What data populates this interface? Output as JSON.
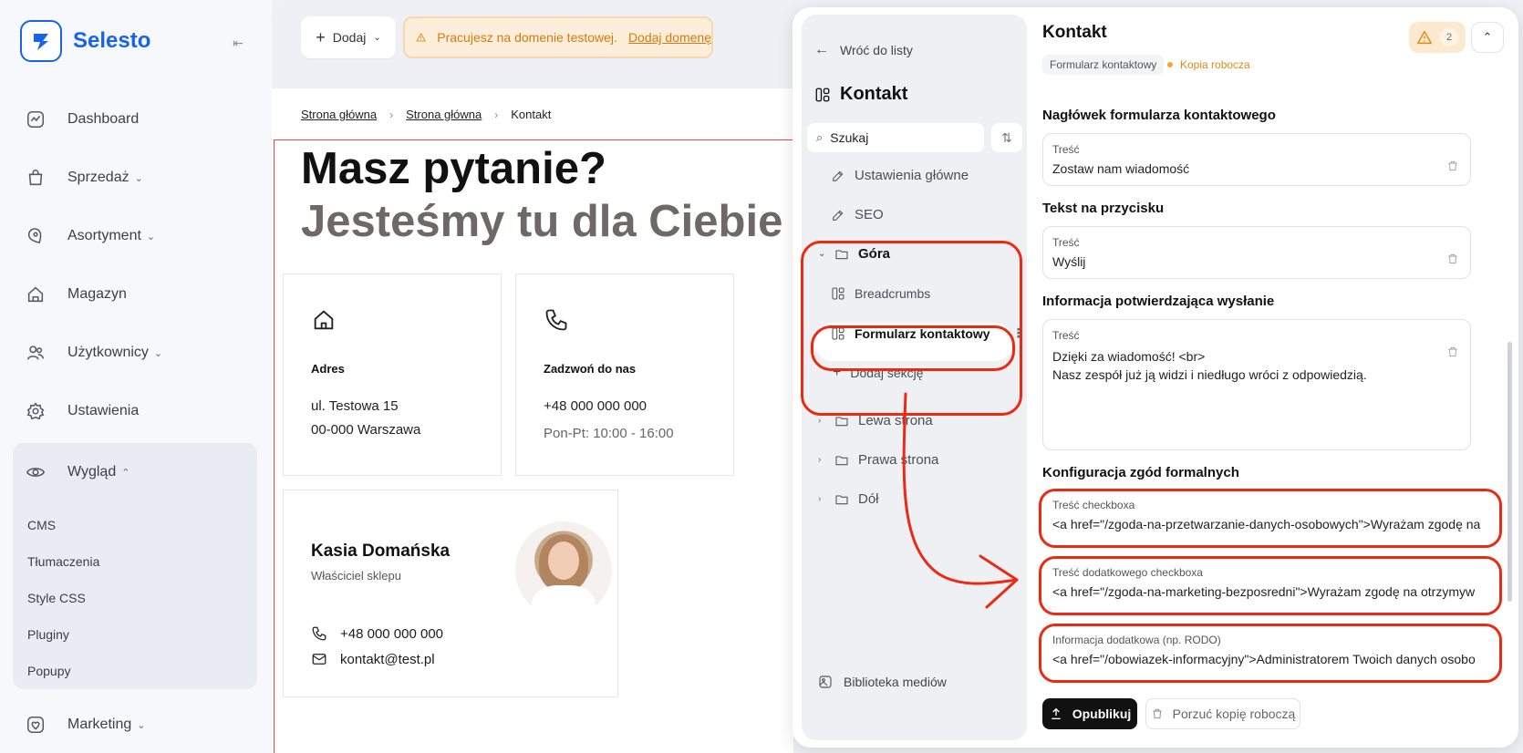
{
  "brand": {
    "name": "Selesto"
  },
  "sidebar": {
    "items": [
      {
        "label": "Dashboard",
        "icon": "chart-line-icon",
        "has_chevron": false
      },
      {
        "label": "Sprzedaż",
        "icon": "shopping-bag-icon",
        "has_chevron": true
      },
      {
        "label": "Asortyment",
        "icon": "tag-icon",
        "has_chevron": true
      },
      {
        "label": "Magazyn",
        "icon": "warehouse-icon",
        "has_chevron": false
      },
      {
        "label": "Użytkownicy",
        "icon": "users-icon",
        "has_chevron": true
      },
      {
        "label": "Ustawienia",
        "icon": "gear-icon",
        "has_chevron": false
      }
    ],
    "appearance": {
      "label": "Wygląd",
      "icon": "eye-icon",
      "subitems": [
        "CMS",
        "Tłumaczenia",
        "Style CSS",
        "Pluginy",
        "Popupy"
      ]
    },
    "marketing": {
      "label": "Marketing",
      "icon": "heart-icon"
    }
  },
  "topbar": {
    "add_label": "Dodaj",
    "warning_text": "Pracujesz na domenie testowej.",
    "warning_link": "Dodaj domenę"
  },
  "breadcrumb": [
    "Strona główna",
    "Strona główna",
    "Kontakt"
  ],
  "hero": {
    "title": "Masz pytanie?",
    "subtitle": "Jesteśmy tu dla Ciebie"
  },
  "cards": {
    "address": {
      "title": "Adres",
      "line1": "ul. Testowa 15",
      "line2": "00-000 Warszawa"
    },
    "phone": {
      "title": "Zadzwoń do nas",
      "line1": "+48 000 000 000",
      "hours": "Pon-Pt: 10:00 - 16:00"
    },
    "person": {
      "name": "Kasia Domańska",
      "role": "Właściciel sklepu",
      "phone": "+48 000 000 000",
      "email": "kontakt@test.pl"
    }
  },
  "tree": {
    "back_label": "Wróć do listy",
    "title": "Kontakt",
    "search_placeholder": "Szukaj",
    "items": {
      "main_settings": "Ustawienia główne",
      "seo": "SEO",
      "top": "Góra",
      "breadcrumbs": "Breadcrumbs",
      "contact_form": "Formularz kontaktowy",
      "add_section": "Dodaj sekcję",
      "left": "Lewa strona",
      "right": "Prawa strona",
      "bottom": "Dół"
    },
    "media_library": "Biblioteka mediów"
  },
  "editor": {
    "title": "Kontakt",
    "tag": "Formularz kontaktowy",
    "status": "Kopia robocza",
    "warning_count": "2",
    "sections": {
      "header": {
        "title": "Nagłówek formularza kontaktowego",
        "label": "Treść",
        "value": "Zostaw nam wiadomość"
      },
      "button": {
        "title": "Tekst na przycisku",
        "label": "Treść",
        "value": "Wyślij"
      },
      "confirm": {
        "title": "Informacja potwierdzająca wysłanie",
        "label": "Treść",
        "line1": "Dzięki za wiadomość! <br>",
        "line2": "Nasz zespół już ją widzi i niedługo wróci z odpowiedzią."
      },
      "consents": {
        "title": "Konfiguracja zgód formalnych",
        "checkbox": {
          "label": "Treść checkboxa",
          "value": "<a href=\"/zgoda-na-przetwarzanie-danych-osobowych\">Wyrażam zgodę na"
        },
        "extra_checkbox": {
          "label": "Treść dodatkowego checkboxa",
          "value": "<a href=\"/zgoda-na-marketing-bezposredni\">Wyrażam zgodę na otrzymyw"
        },
        "rodo": {
          "label": "Informacja dodatkowa (np. RODO)",
          "value": "<a href=\"/obowiazek-informacyjny\">Administratorem Twoich danych osobo"
        }
      }
    },
    "publish_label": "Opublikuj",
    "discard_label": "Porzuć kopię roboczą"
  }
}
